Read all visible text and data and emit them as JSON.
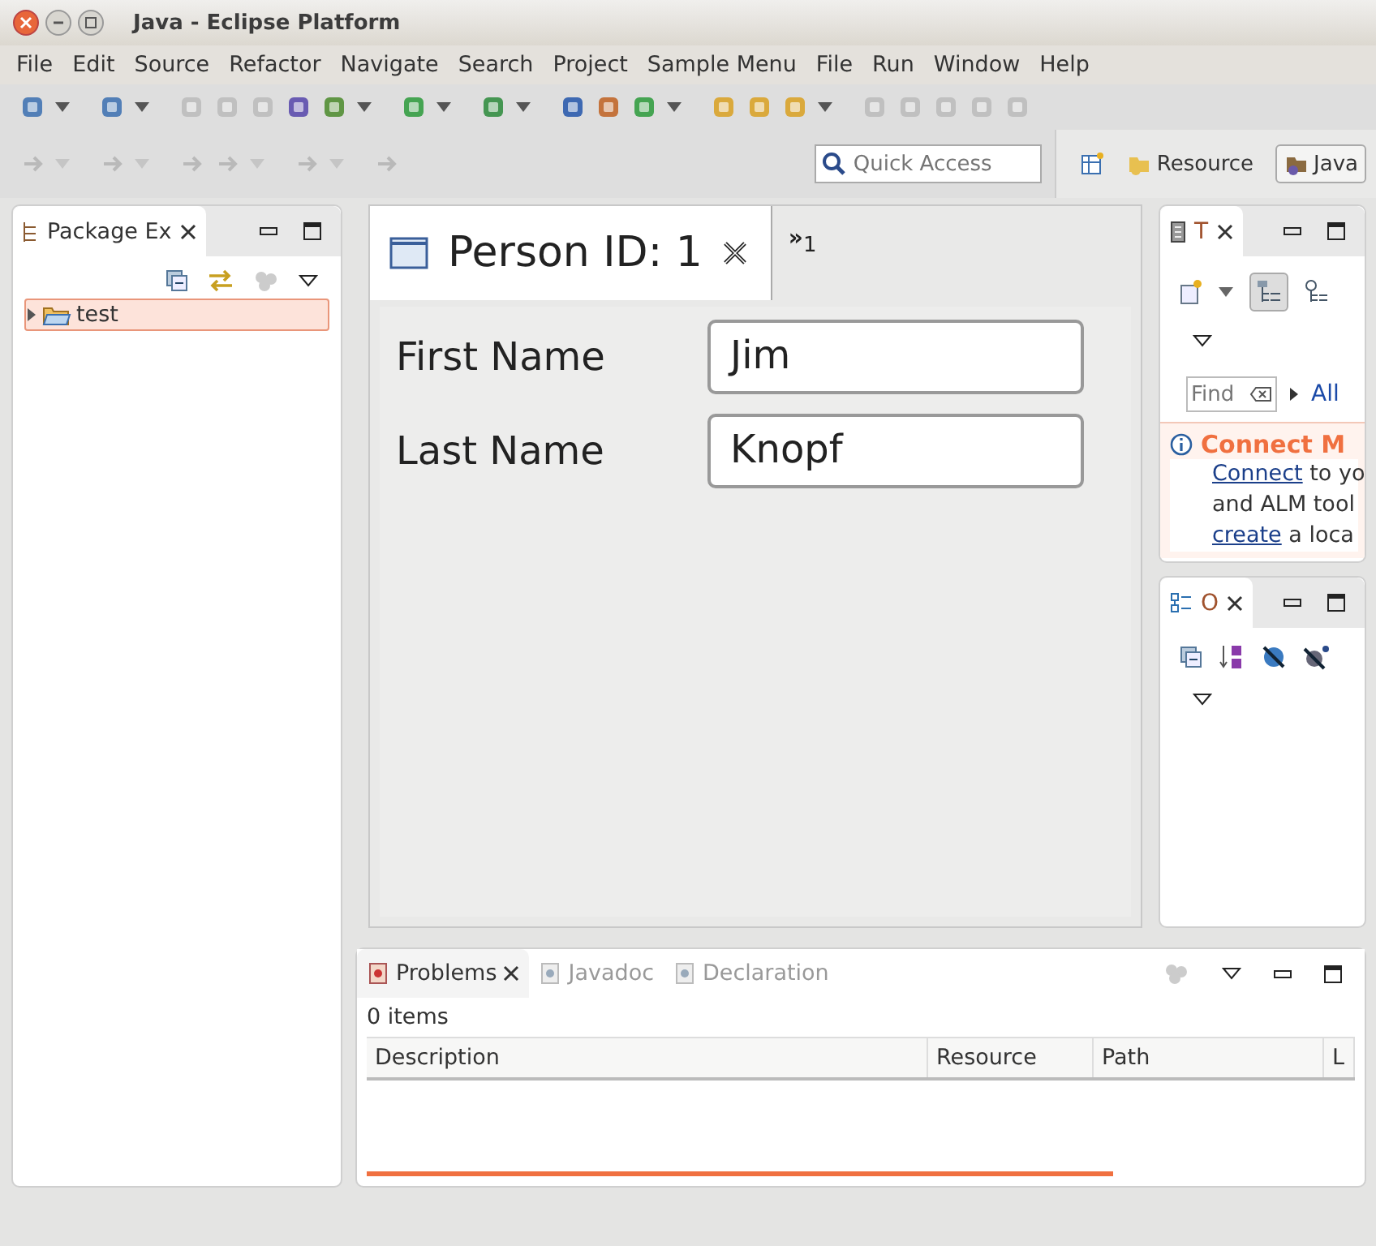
{
  "window": {
    "title": "Java - Eclipse Platform"
  },
  "menu": [
    "File",
    "Edit",
    "Source",
    "Refactor",
    "Navigate",
    "Search",
    "Project",
    "Sample Menu",
    "File",
    "Run",
    "Window",
    "Help"
  ],
  "quick_access": {
    "placeholder": "Quick Access"
  },
  "perspectives": [
    {
      "label": "Resource",
      "selected": false
    },
    {
      "label": "Java",
      "selected": true
    }
  ],
  "package_explorer": {
    "tab": "Package Ex",
    "tree": [
      {
        "label": "test",
        "selected": true,
        "expanded": false
      }
    ]
  },
  "editor": {
    "tabs": [
      {
        "label": "Person ID: 1",
        "selected": true
      }
    ],
    "overflow": {
      "symbol": "»",
      "count": "1"
    },
    "fields": [
      {
        "label": "First Name",
        "value": "Jim"
      },
      {
        "label": "Last Name",
        "value": "Knopf"
      }
    ]
  },
  "task_list": {
    "tab": "T",
    "find": {
      "placeholder": "Find"
    },
    "filter_link": "All",
    "connect_title": "Connect M",
    "lines": [
      [
        {
          "kind": "link",
          "text": "Connect"
        },
        {
          "kind": "text",
          "text": " to yo"
        }
      ],
      [
        {
          "kind": "text",
          "text": "and ALM tool"
        }
      ],
      [
        {
          "kind": "link",
          "text": "create"
        },
        {
          "kind": "text",
          "text": " a loca"
        }
      ]
    ]
  },
  "outline": {
    "tab": "O"
  },
  "problems": {
    "tabs": [
      {
        "label": "Problems",
        "selected": true
      },
      {
        "label": "Javadoc",
        "selected": false
      },
      {
        "label": "Declaration",
        "selected": false
      }
    ],
    "summary": "0 items",
    "columns": [
      "Description",
      "Resource",
      "Path",
      "L"
    ]
  }
}
